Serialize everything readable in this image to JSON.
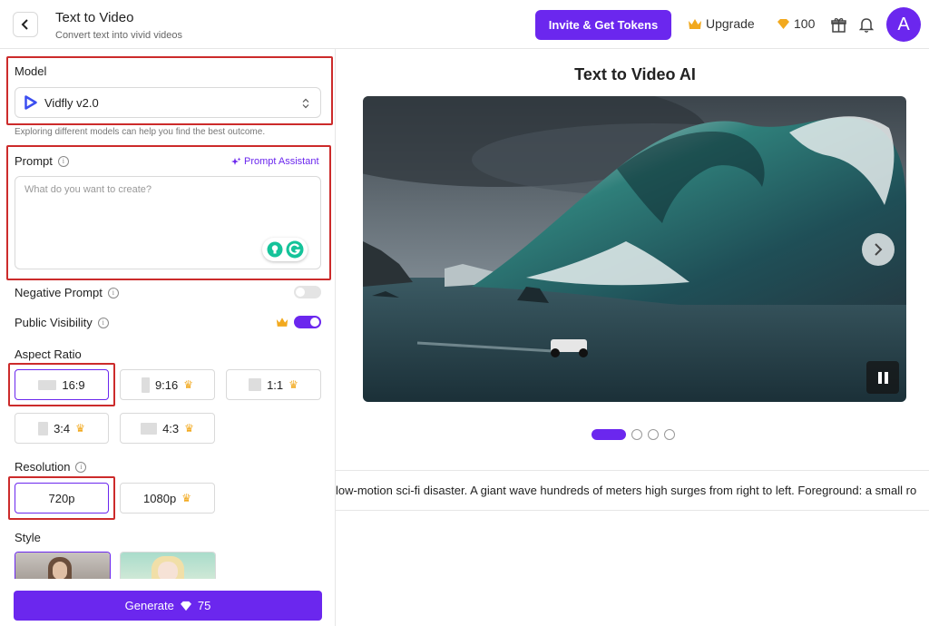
{
  "header": {
    "title": "Text to Video",
    "subtitle": "Convert text into vivid videos",
    "invite_label": "Invite & Get Tokens",
    "upgrade_label": "Upgrade",
    "tokens_count": "100",
    "avatar_initial": "A"
  },
  "left": {
    "model_label": "Model",
    "model_value": "Vidfly v2.0",
    "model_hint": "Exploring different models can help you find the best outcome.",
    "prompt_label": "Prompt",
    "prompt_assistant": "Prompt Assistant",
    "prompt_placeholder": "What do you want to create?",
    "negative_prompt_label": "Negative Prompt",
    "negative_prompt_on": false,
    "public_visibility_label": "Public Visibility",
    "public_visibility_on": true,
    "aspect_ratio_label": "Aspect Ratio",
    "aspect_ratios": [
      {
        "label": "16:9",
        "selected": true,
        "premium": false
      },
      {
        "label": "9:16",
        "selected": false,
        "premium": true
      },
      {
        "label": "1:1",
        "selected": false,
        "premium": true
      },
      {
        "label": "3:4",
        "selected": false,
        "premium": true
      },
      {
        "label": "4:3",
        "selected": false,
        "premium": true
      }
    ],
    "resolution_label": "Resolution",
    "resolutions": [
      {
        "label": "720p",
        "selected": true,
        "premium": false
      },
      {
        "label": "1080p",
        "selected": false,
        "premium": true
      }
    ],
    "style_label": "Style",
    "generate_label": "Generate",
    "generate_cost": "75"
  },
  "right": {
    "title": "Text to Video AI",
    "carousel_count": 4,
    "carousel_active": 1,
    "caption": "low-motion sci-fi disaster. A giant wave hundreds of meters high surges from right to left. Foreground: a small ro"
  },
  "colors": {
    "accent": "#6b27ee",
    "highlight": "#cc2b2b",
    "crown": "#f2a91e"
  }
}
